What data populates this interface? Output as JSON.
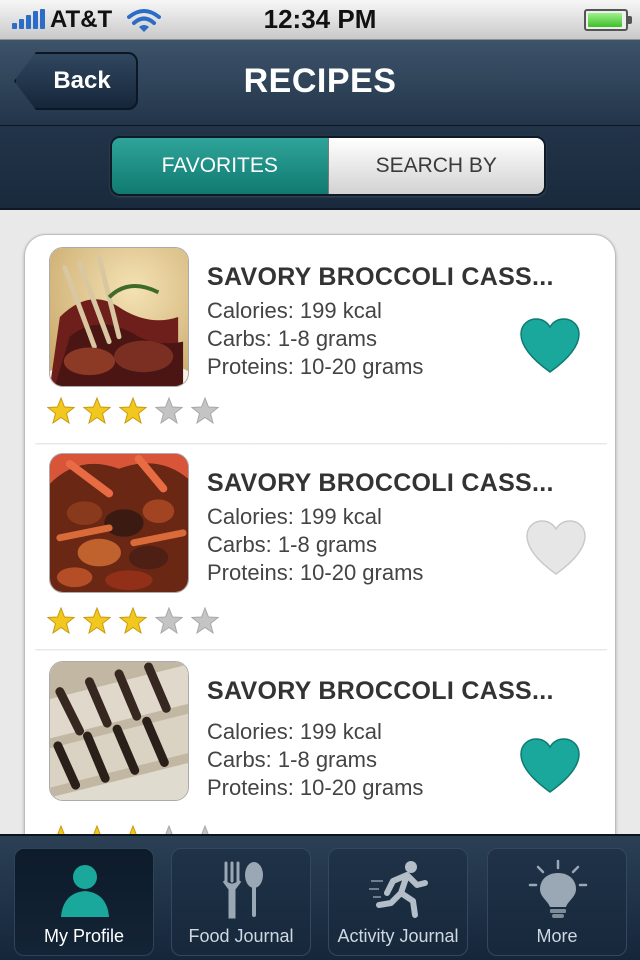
{
  "status_bar": {
    "carrier": "AT&T",
    "time": "12:34 PM"
  },
  "nav": {
    "back_label": "Back",
    "title": "RECIPES"
  },
  "segments": {
    "favorites": "FAVORITES",
    "search_by": "SEARCH BY",
    "active": "favorites"
  },
  "recipes": [
    {
      "title": "SAVORY BROCCOLI CASS...",
      "calories": "Calories: 199 kcal",
      "carbs": "Carbs: 1-8 grams",
      "proteins": "Proteins: 10-20 grams",
      "rating": 3,
      "max_rating": 5,
      "favorite": true,
      "image": "roast-meat-dish"
    },
    {
      "title": "SAVORY BROCCOLI CASS...",
      "calories": "Calories: 199 kcal",
      "carbs": "Carbs: 1-8 grams",
      "proteins": "Proteins: 10-20 grams",
      "rating": 3,
      "max_rating": 5,
      "favorite": false,
      "image": "stew-dish"
    },
    {
      "title": "SAVORY BROCCOLI CASS...",
      "calories": "Calories: 199 kcal",
      "carbs": "Carbs: 1-8 grams",
      "proteins": "Proteins: 10-20 grams",
      "rating": 3,
      "max_rating": 5,
      "favorite": true,
      "image": "grilled-tofu-dish"
    }
  ],
  "tabs": [
    {
      "label": "My Profile",
      "icon": "person-icon",
      "active": true
    },
    {
      "label": "Food Journal",
      "icon": "fork-spoon-icon",
      "active": false
    },
    {
      "label": "Activity Journal",
      "icon": "runner-icon",
      "active": false
    },
    {
      "label": "More",
      "icon": "lightbulb-icon",
      "active": false
    }
  ],
  "colors": {
    "accent": "#1aa79c",
    "nav_dark": "#23354a",
    "star_gold": "#f2c81e",
    "star_gray": "#c4c4c4",
    "heart_off": "#e6e6e6"
  }
}
